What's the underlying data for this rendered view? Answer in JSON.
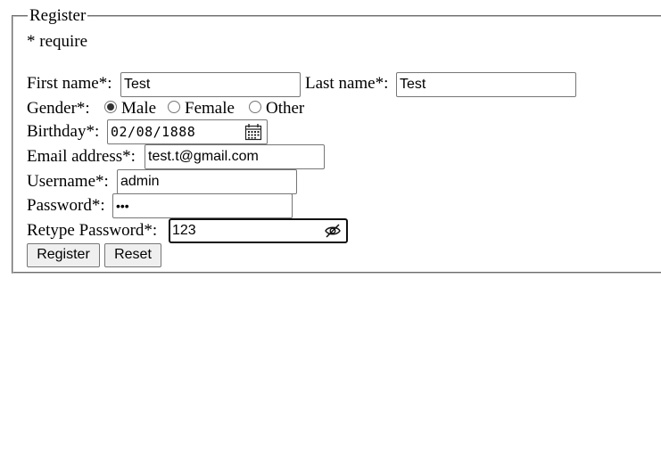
{
  "form": {
    "legend": "Register",
    "require_note": "* require",
    "first_name": {
      "label": "First name*:",
      "value": "Test"
    },
    "last_name": {
      "label": "Last name*:",
      "value": "Test"
    },
    "gender": {
      "label": "Gender*:",
      "options": [
        "Male",
        "Female",
        "Other"
      ],
      "selected": "Male"
    },
    "birthday": {
      "label": "Birthday*:",
      "value": "02/08/1888",
      "icon": "calendar-icon"
    },
    "email": {
      "label": "Email address*:",
      "value": "test.t@gmail.com"
    },
    "username": {
      "label": "Username*:",
      "value": "admin"
    },
    "password": {
      "label": "Password*:",
      "value": "•••"
    },
    "retype_password": {
      "label": "Retype Password*:",
      "value": "123",
      "icon": "eye-slash-icon"
    },
    "buttons": {
      "register": "Register",
      "reset": "Reset"
    }
  }
}
